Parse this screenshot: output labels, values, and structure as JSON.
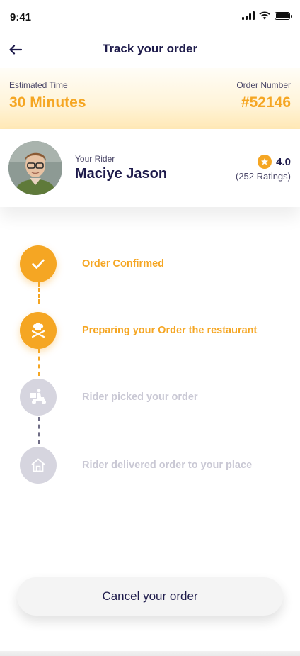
{
  "status_bar": {
    "time": "9:41"
  },
  "header": {
    "title": "Track your order",
    "back_icon": "arrow-left-icon"
  },
  "estimate": {
    "time_label": "Estimated Time",
    "time_value": "30 Minutes",
    "order_label": "Order Number",
    "order_value": "#52146"
  },
  "rider": {
    "label": "Your Rider",
    "name": "Maciye Jason",
    "rating": "4.0",
    "ratings_count": "(252 Ratings)"
  },
  "steps": [
    {
      "label": "Order Confirmed",
      "status": "done",
      "icon": "check-icon"
    },
    {
      "label": "Preparing your Order the restaurant",
      "status": "active",
      "icon": "chef-icon"
    },
    {
      "label": "Rider picked your order",
      "status": "pending",
      "icon": "delivery-scooter-icon"
    },
    {
      "label": "Rider delivered order to your place",
      "status": "pending",
      "icon": "home-icon"
    }
  ],
  "actions": {
    "cancel_label": "Cancel your order"
  },
  "colors": {
    "accent": "#f5a623",
    "text_dark": "#1e1b4b",
    "inactive": "#d6d5df"
  }
}
